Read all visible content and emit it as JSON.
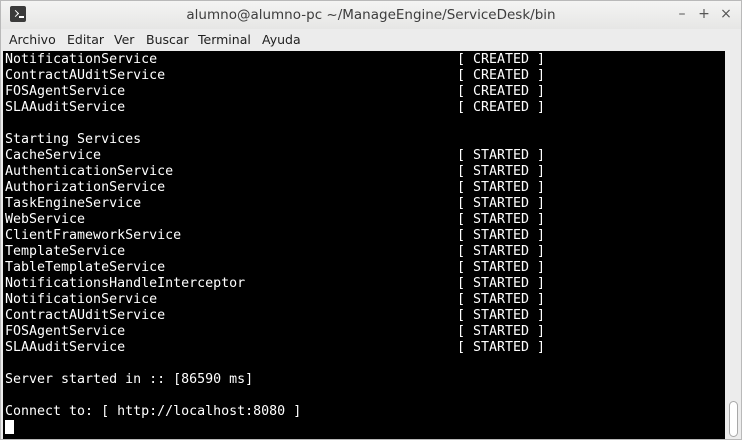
{
  "window": {
    "title": "alumno@alumno-pc ~/ManageEngine/ServiceDesk/bin",
    "controls": {
      "minimize": "–",
      "maximize": "+",
      "close": "×"
    }
  },
  "menubar": {
    "items": [
      "Archivo",
      "Editar",
      "Ver",
      "Buscar",
      "Terminal",
      "Ayuda"
    ]
  },
  "terminal": {
    "lines": [
      {
        "name": "NotificationService",
        "status": "[ CREATED ]"
      },
      {
        "name": "ContractAUditService",
        "status": "[ CREATED ]"
      },
      {
        "name": "FOSAgentService",
        "status": "[ CREATED ]"
      },
      {
        "name": "SLAAuditService",
        "status": "[ CREATED ]"
      },
      {
        "name": "",
        "status": ""
      },
      {
        "name": "Starting Services",
        "status": ""
      },
      {
        "name": "CacheService",
        "status": "[ STARTED ]"
      },
      {
        "name": "AuthenticationService",
        "status": "[ STARTED ]"
      },
      {
        "name": "AuthorizationService",
        "status": "[ STARTED ]"
      },
      {
        "name": "TaskEngineService",
        "status": "[ STARTED ]"
      },
      {
        "name": "WebService",
        "status": "[ STARTED ]"
      },
      {
        "name": "ClientFrameworkService",
        "status": "[ STARTED ]"
      },
      {
        "name": "TemplateService",
        "status": "[ STARTED ]"
      },
      {
        "name": "TableTemplateService",
        "status": "[ STARTED ]"
      },
      {
        "name": "NotificationsHandleInterceptor",
        "status": "[ STARTED ]"
      },
      {
        "name": "NotificationService",
        "status": "[ STARTED ]"
      },
      {
        "name": "ContractAUditService",
        "status": "[ STARTED ]"
      },
      {
        "name": "FOSAgentService",
        "status": "[ STARTED ]"
      },
      {
        "name": "SLAAuditService",
        "status": "[ STARTED ]"
      },
      {
        "name": "",
        "status": ""
      },
      {
        "name": "Server started in :: [86590 ms]",
        "status": ""
      },
      {
        "name": "",
        "status": ""
      },
      {
        "name": "Connect to: [ http://localhost:8080 ]",
        "status": ""
      }
    ]
  },
  "colors": {
    "terminal_bg": "#000000",
    "terminal_fg": "#ffffff",
    "chrome": "#ececec"
  },
  "icons": {
    "app": "terminal-icon",
    "minimize": "minimize-icon",
    "maximize": "maximize-icon",
    "close": "close-icon"
  }
}
